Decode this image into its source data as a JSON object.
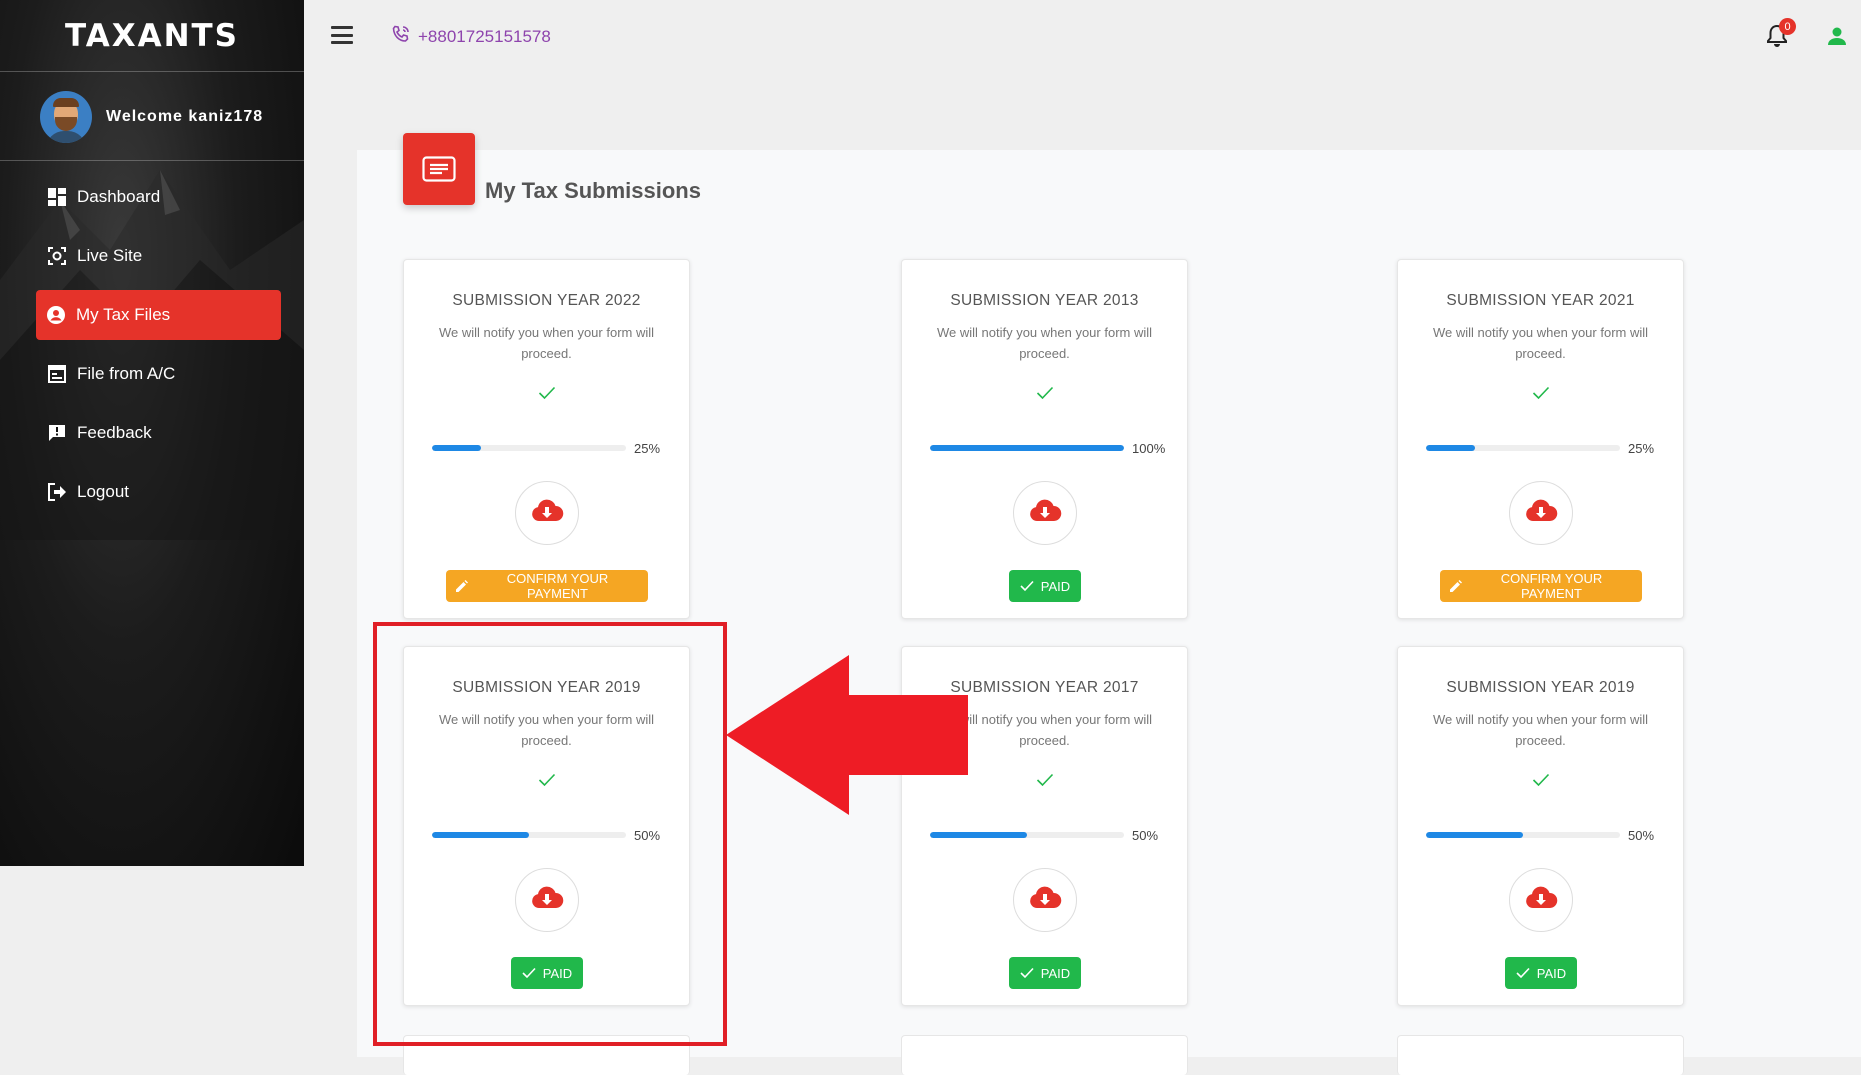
{
  "sidebar": {
    "logo": "TAXANTS",
    "welcome": "Welcome kaniz178",
    "items": [
      {
        "label": "Dashboard",
        "icon": "dashboard-icon"
      },
      {
        "label": "Live Site",
        "icon": "live-site-icon"
      },
      {
        "label": "My Tax Files",
        "icon": "account-icon",
        "active": true
      },
      {
        "label": "File from A/C",
        "icon": "file-icon"
      },
      {
        "label": "Feedback",
        "icon": "feedback-icon"
      },
      {
        "label": "Logout",
        "icon": "logout-icon"
      }
    ]
  },
  "topbar": {
    "phone": "+8801725151578",
    "notification_count": "0"
  },
  "main": {
    "title": "My Tax Submissions",
    "cards": [
      {
        "year": "SUBMISSION YEAR 2022",
        "message": "We will notify you when your form will proceed.",
        "progress": 25,
        "progress_label": "25%",
        "button": "CONFIRM YOUR PAYMENT",
        "status": "confirm"
      },
      {
        "year": "SUBMISSION YEAR 2013",
        "message": "We will notify you when your form will proceed.",
        "progress": 100,
        "progress_label": "100%",
        "button": "PAID",
        "status": "paid"
      },
      {
        "year": "SUBMISSION YEAR 2021",
        "message": "We will notify you when your form will proceed.",
        "progress": 25,
        "progress_label": "25%",
        "button": "CONFIRM YOUR PAYMENT",
        "status": "confirm"
      },
      {
        "year": "SUBMISSION YEAR 2019",
        "message": "We will notify you when your form will proceed.",
        "progress": 50,
        "progress_label": "50%",
        "button": "PAID",
        "status": "paid"
      },
      {
        "year": "SUBMISSION YEAR 2017",
        "message": "We will notify you when your form will proceed.",
        "progress": 50,
        "progress_label": "50%",
        "button": "PAID",
        "status": "paid"
      },
      {
        "year": "SUBMISSION YEAR 2019",
        "message": "We will notify you when your form will proceed.",
        "progress": 50,
        "progress_label": "50%",
        "button": "PAID",
        "status": "paid"
      }
    ]
  },
  "colors": {
    "accent_red": "#e5332a",
    "confirm_orange": "#f5a623",
    "paid_green": "#21b84b",
    "progress_blue": "#1e88e5",
    "phone_purple": "#8e44ad"
  }
}
